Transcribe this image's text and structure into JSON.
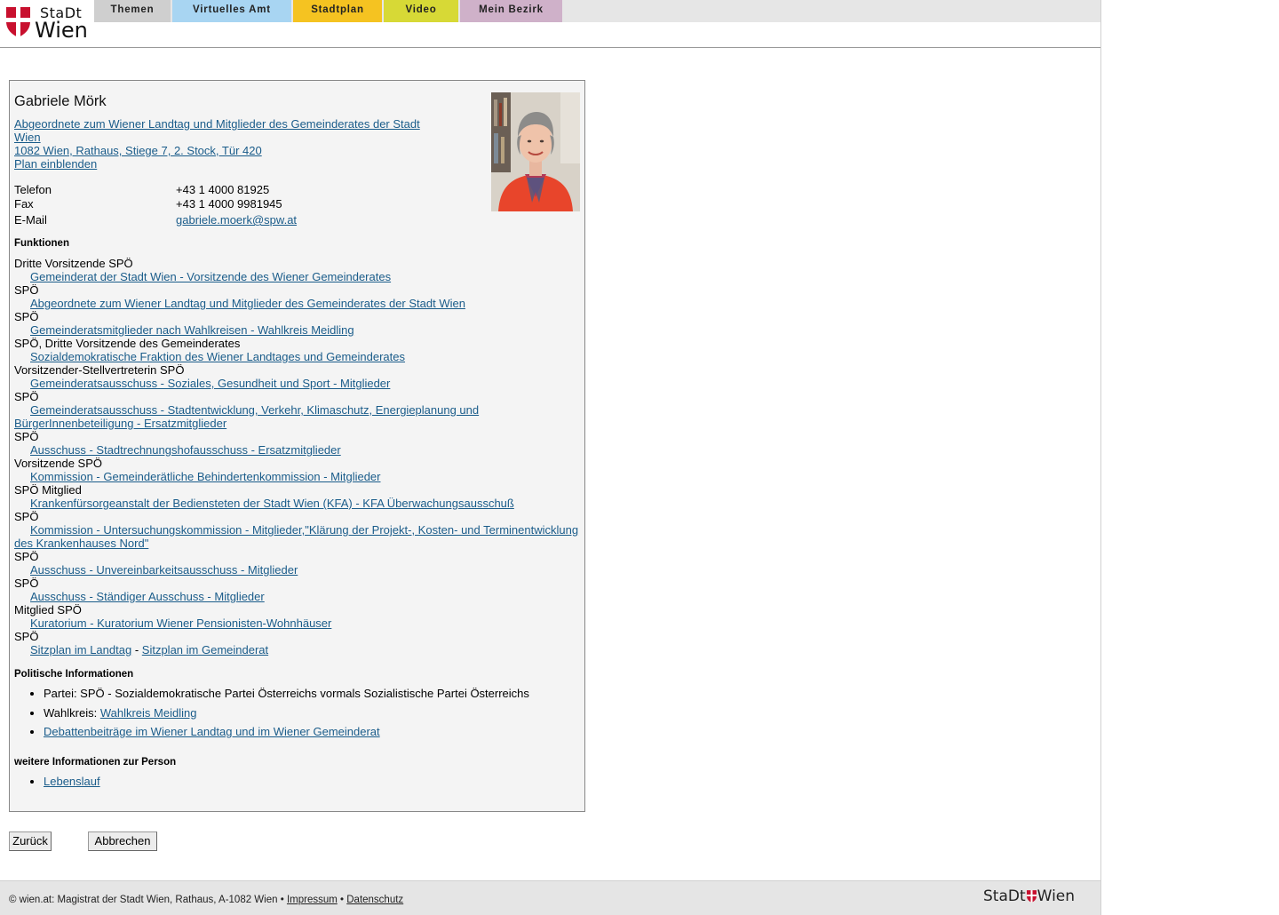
{
  "header": {
    "logo": {
      "line1": "StaDt",
      "line2": "Wien"
    },
    "nav": [
      {
        "label": "Themen"
      },
      {
        "label": "Virtuelles Amt"
      },
      {
        "label": "Stadtplan"
      },
      {
        "label": "Video"
      },
      {
        "label": "Mein Bezirk"
      }
    ],
    "colors": {
      "themen": "#cfcfcf",
      "amt": "#a8d5f2",
      "stadtplan": "#f5c321",
      "video": "#d7d936",
      "bezirk": "#cfb1c9",
      "shield_red": "#c8102e"
    }
  },
  "person": {
    "name": "Gabriele Mörk",
    "address_line1": "Abgeordnete zum Wiener Landtag und Mitglieder des Gemeinderates der Stadt",
    "address_line2": "Wien",
    "address_line3": "1082 Wien, Rathaus, Stiege 7, 2. Stock, Tür 420",
    "plan_link": "Plan einblenden",
    "contact": [
      {
        "label": "Telefon",
        "value": "+43 1 4000 81925"
      },
      {
        "label": "Fax",
        "value": "+43 1 4000 9981945"
      },
      {
        "label": "E-Mail",
        "value": "gabriele.moerk@spw.at"
      }
    ]
  },
  "functions": {
    "title": "Funktionen",
    "items": [
      {
        "role": "Dritte Vorsitzende SPÖ",
        "link": "Gemeinderat der Stadt Wien - Vorsitzende des Wiener Gemeinderates"
      },
      {
        "role": "SPÖ",
        "link": "Abgeordnete zum Wiener Landtag und Mitglieder des Gemeinderates der Stadt Wien"
      },
      {
        "role": "SPÖ",
        "link": "Gemeinderatsmitglieder nach Wahlkreisen - Wahlkreis Meidling"
      },
      {
        "role": "SPÖ, Dritte Vorsitzende des Gemeinderates",
        "link": "Sozialdemokratische Fraktion des Wiener Landtages und Gemeinderates"
      },
      {
        "role": "Vorsitzender-Stellvertreterin SPÖ",
        "link": "Gemeinderatsausschuss - Soziales, Gesundheit und Sport - Mitglieder"
      },
      {
        "role": "SPÖ",
        "link": "Gemeinderatsausschuss - Stadtentwicklung, Verkehr, Klimaschutz, Energieplanung und",
        "link_cont": "BürgerInnenbeteiligung - Ersatzmitglieder"
      },
      {
        "role": "SPÖ",
        "link": "Ausschuss - Stadtrechnungshofausschuss - Ersatzmitglieder"
      },
      {
        "role": "Vorsitzende SPÖ",
        "link": "Kommission - Gemeinderätliche Behindertenkommission - Mitglieder"
      },
      {
        "role": "SPÖ Mitglied",
        "link": "Krankenfürsorgeanstalt der Bediensteten der Stadt Wien (KFA) - KFA Überwachungsausschuß"
      },
      {
        "role": "SPÖ",
        "link": "Kommission - Untersuchungskommission - Mitglieder,\"Klärung der Projekt-, Kosten- und Terminentwicklung",
        "link_cont": "des Krankenhauses Nord\""
      },
      {
        "role": "SPÖ",
        "link": "Ausschuss - Unvereinbarkeitsausschuss - Mitglieder"
      },
      {
        "role": "SPÖ",
        "link": "Ausschuss - Ständiger Ausschuss - Mitglieder"
      },
      {
        "role": "Mitglied SPÖ",
        "link": "Kuratorium - Kuratorium Wiener Pensionisten-Wohnhäuser"
      },
      {
        "role": "SPÖ",
        "link": ""
      }
    ],
    "seat_landtag": "Sitzplan im Landtag",
    "seat_separator": "-",
    "seat_gemeinderat": "Sitzplan im Gemeinderat"
  },
  "political": {
    "title": "Politische Informationen",
    "party": "Partei: SPÖ - Sozialdemokratische Partei Österreichs vormals Sozialistische Partei Österreichs",
    "wahlkreis_label": "Wahlkreis:",
    "wahlkreis_link": "Wahlkreis Meidling",
    "debates_link": "Debattenbeiträge im Wiener Landtag und im Wiener Gemeinderat"
  },
  "further": {
    "title": "weitere Informationen zur Person",
    "cv_link": "Lebenslauf"
  },
  "buttons": {
    "back": "Zurück",
    "cancel": "Abbrechen"
  },
  "footer": {
    "text": "© wien.at: Magistrat der Stadt Wien, Rathaus, A-1082 Wien •",
    "impressum": "Impressum",
    "separator": "•",
    "datenschutz": "Datenschutz",
    "logo_left": "StaDt",
    "logo_right": "Wien"
  }
}
